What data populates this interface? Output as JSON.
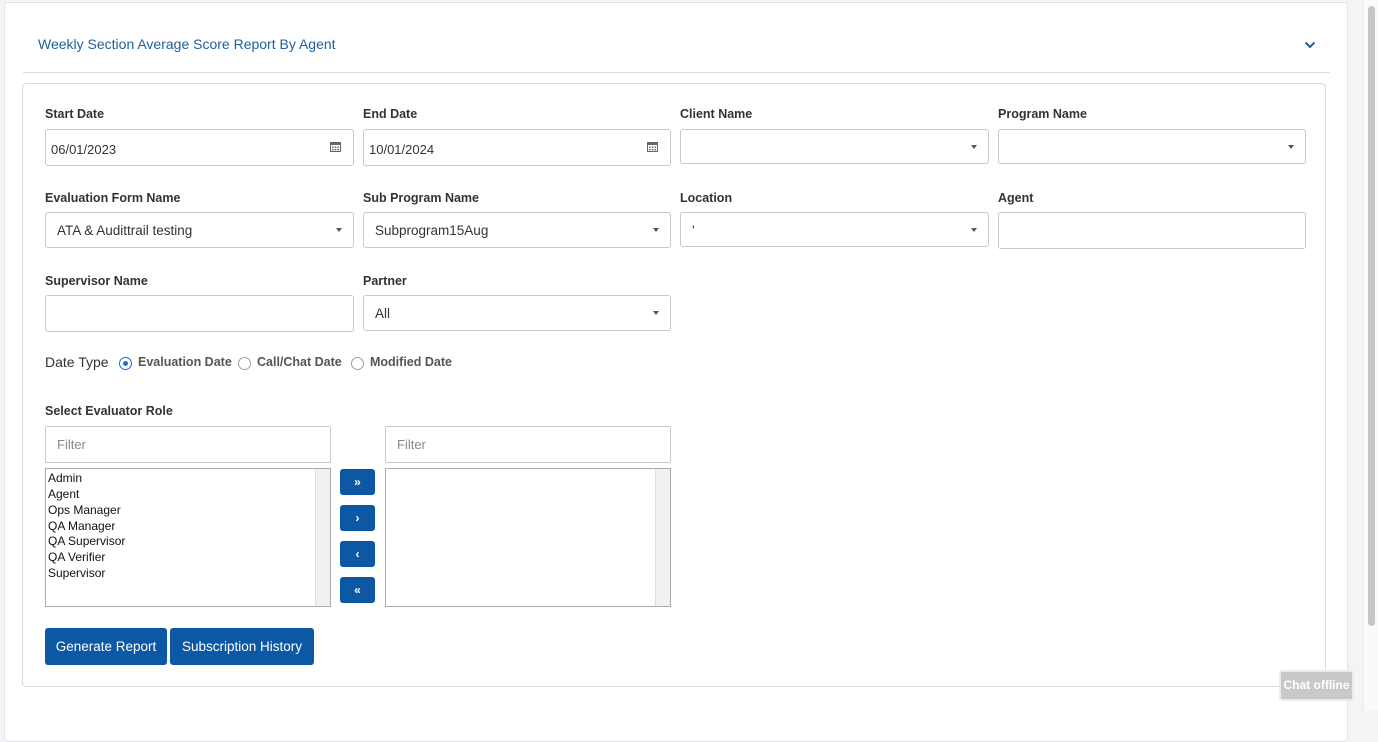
{
  "report": {
    "title": "Weekly Section Average Score Report By Agent"
  },
  "fields": {
    "start_date": {
      "label": "Start Date",
      "value": "06/01/2023"
    },
    "end_date": {
      "label": "End Date",
      "value": "10/01/2024"
    },
    "client_name": {
      "label": "Client Name",
      "value": ""
    },
    "program_name": {
      "label": "Program Name",
      "value": ""
    },
    "evaluation_form_name": {
      "label": "Evaluation Form Name",
      "value": "ATA & Audittrail testing"
    },
    "sub_program_name": {
      "label": "Sub Program Name",
      "value": "Subprogram15Aug"
    },
    "location": {
      "label": "Location",
      "value": "'"
    },
    "agent": {
      "label": "Agent",
      "value": ""
    },
    "supervisor_name": {
      "label": "Supervisor Name",
      "value": ""
    },
    "partner": {
      "label": "Partner",
      "value": "All"
    }
  },
  "date_type": {
    "label": "Date Type",
    "options": [
      "Evaluation Date",
      "Call/Chat Date",
      "Modified Date"
    ],
    "selected": "Evaluation Date"
  },
  "evaluator_role": {
    "label": "Select Evaluator Role",
    "left_filter_placeholder": "Filter",
    "right_filter_placeholder": "Filter",
    "available": [
      "Admin",
      "Agent",
      "Ops Manager",
      "QA Manager",
      "QA Supervisor",
      "QA Verifier",
      "Supervisor"
    ],
    "selected": [],
    "move_buttons": {
      "move_all_right": "»",
      "move_right": "›",
      "move_left": "‹",
      "move_all_left": "«"
    }
  },
  "actions": {
    "generate_report": "Generate Report",
    "subscription_history": "Subscription History"
  },
  "chat": {
    "status": "Chat offline"
  },
  "colors": {
    "primary_button": "#0c58a5",
    "title_link": "#1e5f9e",
    "radio_accent": "#1a6fe0"
  },
  "icons": {
    "collapse": "chevron-down-icon",
    "date_picker": "calendar-icon",
    "dropdown": "caret-down-icon"
  }
}
